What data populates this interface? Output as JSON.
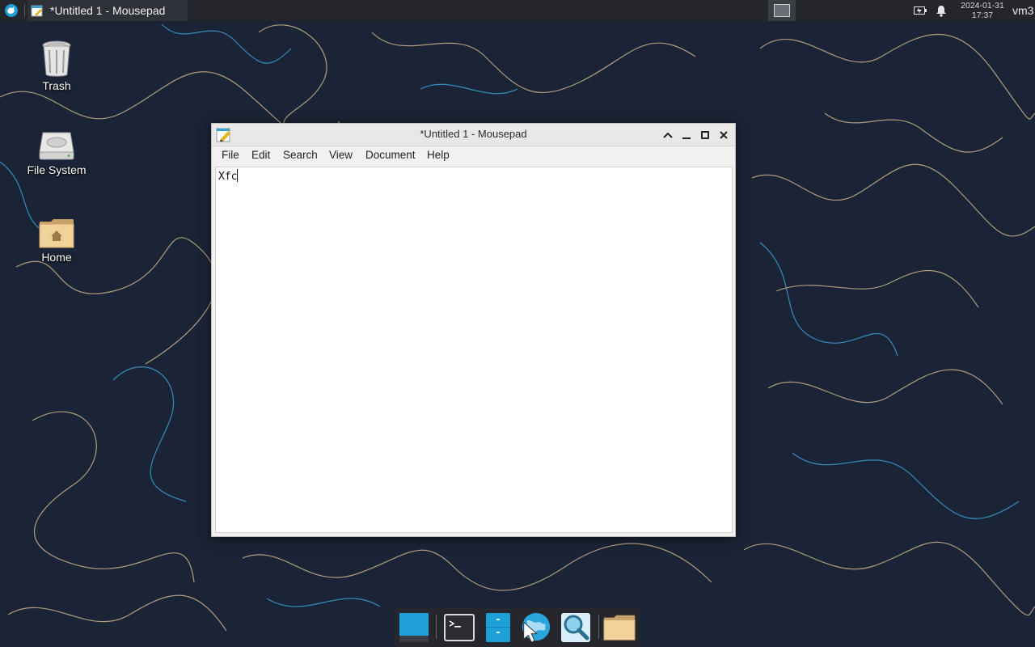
{
  "top_panel": {
    "task_title": "*Untitled 1 - Mousepad",
    "clock_date": "2024-01-31",
    "clock_time": "17:37",
    "user": "vm3"
  },
  "desktop": {
    "icons": [
      {
        "label": "Trash",
        "icon": "trash-icon"
      },
      {
        "label": "File System",
        "icon": "drive-icon"
      },
      {
        "label": "Home",
        "icon": "home-folder-icon"
      }
    ]
  },
  "window": {
    "title": "*Untitled 1 - Mousepad",
    "menu": [
      "File",
      "Edit",
      "Search",
      "View",
      "Document",
      "Help"
    ],
    "editor_text": "Xfc"
  },
  "dock": {
    "items": [
      "show-desktop-icon",
      "terminal-icon",
      "file-manager-icon",
      "web-browser-icon",
      "app-finder-icon",
      "home-folder-icon"
    ]
  },
  "colors": {
    "wallpaper": "#1b2436",
    "panel": "#24262b",
    "accent": "#1e9fd8"
  }
}
